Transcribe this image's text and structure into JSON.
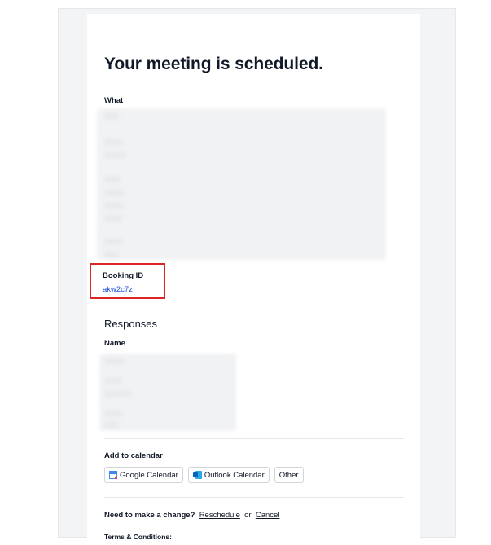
{
  "header": {
    "title": "Your meeting is scheduled."
  },
  "details": {
    "what_label": "What",
    "booking_id_label": "Booking ID",
    "booking_id_value": "akw2c7z"
  },
  "responses": {
    "title": "Responses",
    "name_label": "Name"
  },
  "calendar": {
    "label": "Add to calendar",
    "google_label": "Google Calendar",
    "outlook_label": "Outlook Calendar",
    "other_label": "Other"
  },
  "change": {
    "question": "Need to make a change?",
    "reschedule_label": "Reschedule",
    "or_text": "or",
    "cancel_label": "Cancel"
  },
  "footer": {
    "terms_label": "Terms & Conditions:"
  },
  "colors": {
    "highlight_border": "#dc2626",
    "link": "#1d4ed8"
  }
}
